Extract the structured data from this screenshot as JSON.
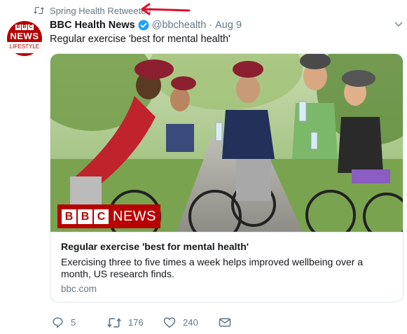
{
  "retweet_context": {
    "text": "Spring Health Retweeted",
    "icon": "retweet-icon"
  },
  "tweet": {
    "avatar": {
      "bbc": [
        "B",
        "B",
        "C"
      ],
      "title": "NEWS",
      "subtitle": "LIFESTYLE"
    },
    "display_name": "BBC Health News",
    "handle": "@bbchealth",
    "separator": "·",
    "date": "Aug 9",
    "text": "Regular exercise 'best for mental health'",
    "card": {
      "image_badge": {
        "blocks": [
          "B",
          "B",
          "C"
        ],
        "word": "NEWS"
      },
      "title": "Regular exercise 'best for mental health'",
      "description": "Exercising three to five times a week helps improved wellbeing over a month, US research finds.",
      "domain": "bbc.com"
    },
    "actions": {
      "reply_count": "5",
      "retweet_count": "176",
      "like_count": "240"
    }
  },
  "colors": {
    "brand_red": "#b80000",
    "annotation_red": "#e0102a",
    "muted": "#657786",
    "verified": "#1da1f2"
  }
}
